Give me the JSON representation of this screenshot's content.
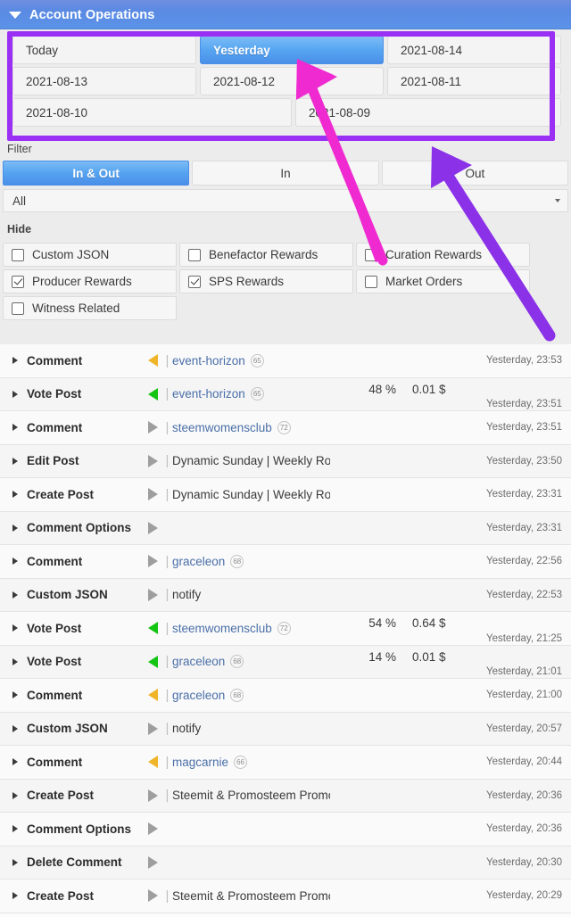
{
  "header": {
    "title": "Account Operations",
    "caret_icon": "triangle-down-icon"
  },
  "dates": {
    "rows": [
      [
        {
          "label": "Today",
          "active": false
        },
        {
          "label": "Yesterday",
          "active": true
        },
        {
          "label": "2021-08-14",
          "active": false
        }
      ],
      [
        {
          "label": "2021-08-13",
          "active": false
        },
        {
          "label": "2021-08-12",
          "active": false
        },
        {
          "label": "2021-08-11",
          "active": false
        }
      ],
      [
        {
          "label": "2021-08-10",
          "active": false
        },
        {
          "label": "2021-08-09",
          "active": false
        }
      ]
    ],
    "highlight_color": "#9b30f5"
  },
  "filter": {
    "label": "Filter",
    "segments": [
      {
        "label": "In & Out",
        "active": true
      },
      {
        "label": "In",
        "active": false
      },
      {
        "label": "Out",
        "active": false
      }
    ],
    "select": {
      "value": "All",
      "caret_icon": "caret-down-icon"
    }
  },
  "hide": {
    "label": "Hide",
    "options": [
      [
        {
          "label": "Custom JSON",
          "checked": false
        },
        {
          "label": "Benefactor Rewards",
          "checked": false
        },
        {
          "label": "Curation Rewards",
          "checked": false
        }
      ],
      [
        {
          "label": "Producer Rewards",
          "checked": true
        },
        {
          "label": "SPS Rewards",
          "checked": true
        },
        {
          "label": "Market Orders",
          "checked": false
        }
      ],
      [
        {
          "label": "Witness Related",
          "checked": false
        }
      ]
    ]
  },
  "operations": [
    {
      "op": "Comment",
      "dir": "in-orange",
      "subject": "event-horizon",
      "link": true,
      "rep": "65",
      "pct": "",
      "value": "",
      "time": "Yesterday, 23:53",
      "two_line": false
    },
    {
      "op": "Vote Post",
      "dir": "in-green",
      "subject": "event-horizon",
      "link": true,
      "rep": "65",
      "pct": "48 %",
      "value": "0.01 $",
      "time": "Yesterday, 23:51",
      "two_line": true
    },
    {
      "op": "Comment",
      "dir": "out",
      "subject": "steemwomensclub",
      "link": true,
      "rep": "72",
      "pct": "",
      "value": "",
      "time": "Yesterday, 23:51",
      "two_line": false
    },
    {
      "op": "Edit Post",
      "dir": "out",
      "subject": "Dynamic Sunday | Weekly Routine & Specia...",
      "link": false,
      "rep": "",
      "pct": "",
      "value": "",
      "time": "Yesterday, 23:50",
      "two_line": false
    },
    {
      "op": "Create Post",
      "dir": "out",
      "subject": "Dynamic Sunday | Weekly Routine & Specia...",
      "link": false,
      "rep": "",
      "pct": "",
      "value": "",
      "time": "Yesterday, 23:31",
      "two_line": false
    },
    {
      "op": "Comment Options",
      "dir": "out",
      "subject": "",
      "link": false,
      "rep": "",
      "pct": "",
      "value": "",
      "time": "Yesterday, 23:31",
      "two_line": false
    },
    {
      "op": "Comment",
      "dir": "out",
      "subject": "graceleon",
      "link": true,
      "rep": "68",
      "pct": "",
      "value": "",
      "time": "Yesterday, 22:56",
      "two_line": false
    },
    {
      "op": "Custom JSON",
      "dir": "out",
      "subject": "notify",
      "link": false,
      "rep": "",
      "pct": "",
      "value": "",
      "time": "Yesterday, 22:53",
      "two_line": false
    },
    {
      "op": "Vote Post",
      "dir": "in-green",
      "subject": "steemwomensclub",
      "link": true,
      "rep": "72",
      "pct": "54 %",
      "value": "0.64 $",
      "time": "Yesterday, 21:25",
      "two_line": true
    },
    {
      "op": "Vote Post",
      "dir": "in-green",
      "subject": "graceleon",
      "link": true,
      "rep": "68",
      "pct": "14 %",
      "value": "0.01 $",
      "time": "Yesterday, 21:01",
      "two_line": true
    },
    {
      "op": "Comment",
      "dir": "in-orange",
      "subject": "graceleon",
      "link": true,
      "rep": "68",
      "pct": "",
      "value": "",
      "time": "Yesterday, 21:00",
      "two_line": false
    },
    {
      "op": "Custom JSON",
      "dir": "out",
      "subject": "notify",
      "link": false,
      "rep": "",
      "pct": "",
      "value": "",
      "time": "Yesterday, 20:57",
      "two_line": false
    },
    {
      "op": "Comment",
      "dir": "in-orange",
      "subject": "magcarnie",
      "link": true,
      "rep": "66",
      "pct": "",
      "value": "",
      "time": "Yesterday, 20:44",
      "two_line": false
    },
    {
      "op": "Create Post",
      "dir": "out",
      "subject": "Steemit & Promosteem Promotion On Social...",
      "link": false,
      "rep": "",
      "pct": "",
      "value": "",
      "time": "Yesterday, 20:36",
      "two_line": false
    },
    {
      "op": "Comment Options",
      "dir": "out",
      "subject": "",
      "link": false,
      "rep": "",
      "pct": "",
      "value": "",
      "time": "Yesterday, 20:36",
      "two_line": false
    },
    {
      "op": "Delete Comment",
      "dir": "out",
      "subject": "",
      "link": false,
      "rep": "",
      "pct": "",
      "value": "",
      "time": "Yesterday, 20:30",
      "two_line": false
    },
    {
      "op": "Create Post",
      "dir": "out",
      "subject": "Steemit & Promosteem Promotion On Social...",
      "link": false,
      "rep": "",
      "pct": "",
      "value": "",
      "time": "Yesterday, 20:29",
      "two_line": false
    }
  ],
  "annotations": {
    "magenta_arrow": {
      "name": "magenta-annotation-arrow",
      "color": "#ef2ad0"
    },
    "purple_arrow": {
      "name": "purple-annotation-arrow",
      "color": "#8b31e8"
    }
  }
}
